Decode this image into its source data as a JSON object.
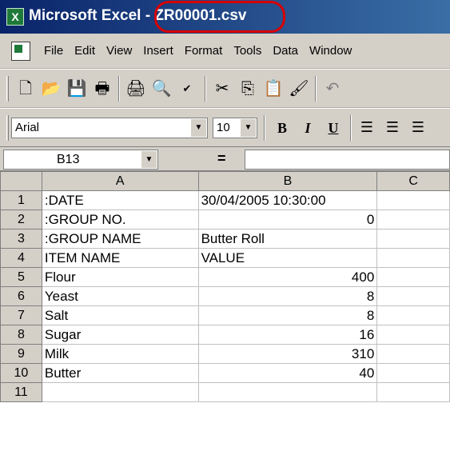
{
  "titlebar": {
    "app_name": "Microsoft Excel",
    "separator": " - ",
    "file_name": "ZR00001.csv"
  },
  "menubar": {
    "items": [
      "File",
      "Edit",
      "View",
      "Insert",
      "Format",
      "Tools",
      "Data",
      "Window"
    ]
  },
  "toolbar": {
    "icons": [
      "new-document-icon",
      "open-folder-icon",
      "save-icon",
      "print-setup-icon",
      "print-icon",
      "print-preview-icon",
      "spelling-icon",
      "cut-icon",
      "copy-icon",
      "paste-icon",
      "format-painter-icon",
      "undo-icon"
    ]
  },
  "formatting": {
    "font": "Arial",
    "size": "10",
    "bold_label": "B",
    "italic_label": "I",
    "underline_label": "U"
  },
  "formula_bar": {
    "cell_ref": "B13",
    "equals": "=",
    "value": ""
  },
  "sheet": {
    "columns": [
      "A",
      "B",
      "C"
    ],
    "rows": [
      {
        "num": "1",
        "a": ":DATE",
        "b": "30/04/2005 10:30:00",
        "b_align": "left"
      },
      {
        "num": "2",
        "a": ":GROUP NO.",
        "b": "0",
        "b_align": "right"
      },
      {
        "num": "3",
        "a": ":GROUP NAME",
        "b": "Butter Roll",
        "b_align": "left"
      },
      {
        "num": "4",
        "a": "ITEM NAME",
        "b": "VALUE",
        "b_align": "left"
      },
      {
        "num": "5",
        "a": "Flour",
        "b": "400",
        "b_align": "right"
      },
      {
        "num": "6",
        "a": "Yeast",
        "b": "8",
        "b_align": "right"
      },
      {
        "num": "7",
        "a": "Salt",
        "b": "8",
        "b_align": "right"
      },
      {
        "num": "8",
        "a": "Sugar",
        "b": "16",
        "b_align": "right"
      },
      {
        "num": "9",
        "a": "Milk",
        "b": "310",
        "b_align": "right"
      },
      {
        "num": "10",
        "a": "Butter",
        "b": "40",
        "b_align": "right"
      },
      {
        "num": "11",
        "a": "",
        "b": "",
        "b_align": "left"
      }
    ]
  },
  "annotation": {
    "highlight_color": "#d80000"
  }
}
